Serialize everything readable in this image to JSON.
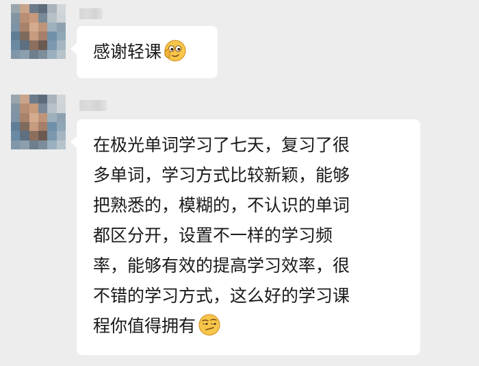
{
  "messages": [
    {
      "sender_name": "轻课",
      "lines": [
        "感谢轻课"
      ],
      "emoji": "thumbs-up-smile-emoji"
    },
    {
      "sender_name": "用户",
      "lines": [
        "在极光单词学习了七天，复习了很",
        "多单词，学习方式比较新颖，能够",
        "把熟悉的，模糊的，不认识的单词",
        "都区分开，设置不一样的学习频",
        "率，能够有效的提高学习效率，很",
        "不错的学习方式，这么好的学习课",
        "程你值得拥有"
      ],
      "emoji": "smirk-emoji"
    }
  ],
  "colors": {
    "background": "#ededed",
    "bubble": "#ffffff",
    "text": "#191919",
    "emoji_face": "#f7c64a"
  }
}
